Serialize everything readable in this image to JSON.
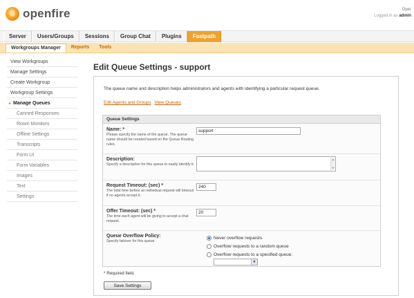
{
  "header": {
    "logo_text": "openfire",
    "user_line": "Oper",
    "logged_in_prefix": "Logged in as",
    "logged_in_user": "admin"
  },
  "main_nav": {
    "tabs": [
      {
        "label": "Server",
        "active": false
      },
      {
        "label": "Users/Groups",
        "active": false
      },
      {
        "label": "Sessions",
        "active": false
      },
      {
        "label": "Group Chat",
        "active": false
      },
      {
        "label": "Plugins",
        "active": false
      },
      {
        "label": "Fastpath",
        "active": true
      }
    ]
  },
  "sub_nav": {
    "tabs": [
      {
        "label": "Workgroups Manager",
        "active": true
      },
      {
        "label": "Reports",
        "active": false
      },
      {
        "label": "Tools",
        "active": false
      }
    ]
  },
  "sidebar": {
    "items": [
      {
        "label": "View Workgroups"
      },
      {
        "label": "Manage Settings"
      },
      {
        "label": "Create Workgroup"
      },
      {
        "label": "Workgroup Settings"
      },
      {
        "label": "Manage Queues"
      },
      {
        "label": "Canned Responses"
      },
      {
        "label": "Room Monitors"
      },
      {
        "label": "Offline Settings"
      },
      {
        "label": "Transcripts"
      },
      {
        "label": "Form UI"
      },
      {
        "label": "Form Variables"
      },
      {
        "label": "Images"
      },
      {
        "label": "Text"
      },
      {
        "label": "Settings"
      }
    ]
  },
  "main": {
    "title": "Edit Queue Settings - support",
    "intro": "The queue name and description helps administrators and agents with identifying a particular request queue.",
    "links": {
      "edit_agents": "Edit Agents and Groups",
      "view_queues": "View Queues"
    },
    "queue_settings": {
      "header": "Queue Settings",
      "name": {
        "label": "Name: *",
        "desc": "Please specify the name of the queue. The queue name should be created based on the Queue Routing rules.",
        "value": "support"
      },
      "description": {
        "label": "Description:",
        "desc": "Specify a description for this queue to easily identify it.",
        "value": ""
      },
      "request_timeout": {
        "label": "Request Timeout: (sec) *",
        "desc": "The total time before an individual request will timeout if no agents accept it.",
        "value": "240"
      },
      "offer_timeout": {
        "label": "Offer Timeout: (sec) *",
        "desc": "The time each agent will be giving to accept a chat request.",
        "value": "20"
      },
      "overflow": {
        "label": "Queue Overflow Policy:",
        "desc": "Specify failover for this queue.",
        "options": [
          {
            "label": "Never overflow requests",
            "checked": true
          },
          {
            "label": "Overflow requests to a random queue",
            "checked": false
          },
          {
            "label": "Overflow requests to a specified queue:",
            "checked": false
          }
        ],
        "select_value": ""
      }
    },
    "required_note": "* Required field.",
    "save_label": "Save Settings"
  }
}
